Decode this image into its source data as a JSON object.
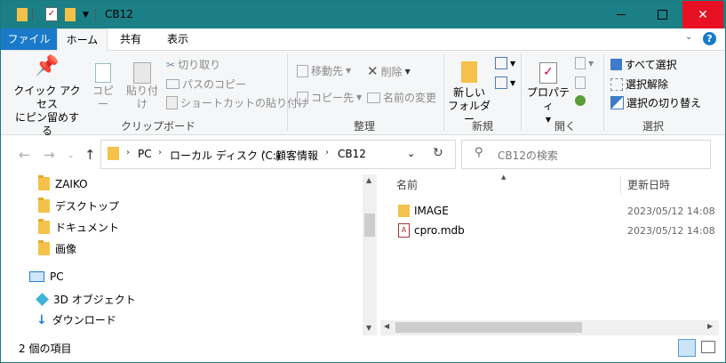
{
  "title": "CB12",
  "ribbon_tabs": {
    "file": "ファイル",
    "home": "ホーム",
    "share": "共有",
    "view": "表示"
  },
  "clipboard": {
    "pin_line1": "クイック アクセス",
    "pin_line2": "にピン留めする",
    "copy": "コピー",
    "paste": "貼り付け",
    "cut": "切り取り",
    "copy_path": "パスのコピー",
    "paste_shortcut": "ショートカットの貼り付け",
    "label": "クリップボード"
  },
  "organize": {
    "move_to": "移動先",
    "copy_to": "コピー先",
    "delete": "削除",
    "rename": "名前の変更",
    "label": "整理"
  },
  "new_group": {
    "new_folder_line1": "新しい",
    "new_folder_line2": "フォルダー",
    "label": "新規"
  },
  "open_group": {
    "properties": "プロパティ",
    "label": "開く"
  },
  "select_group": {
    "select_all": "すべて選択",
    "select_none": "選択解除",
    "invert": "選択の切り替え",
    "label": "選択"
  },
  "address": {
    "segments": [
      "PC",
      "ローカル ディスク (C:)",
      "顧客情報",
      "CB12"
    ]
  },
  "search": {
    "placeholder": "CB12の検索"
  },
  "nav_items": [
    {
      "label": "ZAIKO",
      "icon": "folder-icon"
    },
    {
      "label": "デスクトップ",
      "icon": "folder-icon"
    },
    {
      "label": "ドキュメント",
      "icon": "folder-icon"
    },
    {
      "label": "画像",
      "icon": "folder-icon"
    },
    {
      "label": "PC",
      "icon": "pc-icon"
    },
    {
      "label": "3D オブジェクト",
      "icon": "3d-objects-icon"
    },
    {
      "label": "ダウンロード",
      "icon": "download-icon"
    }
  ],
  "columns": {
    "name": "名前",
    "modified": "更新日時"
  },
  "files": [
    {
      "name": "IMAGE",
      "modified": "2023/05/12 14:08",
      "icon": "folder-icon"
    },
    {
      "name": "cpro.mdb",
      "modified": "2023/05/12 14:08",
      "icon": "access-db-icon"
    }
  ],
  "status": {
    "item_count": "2 個の項目"
  }
}
